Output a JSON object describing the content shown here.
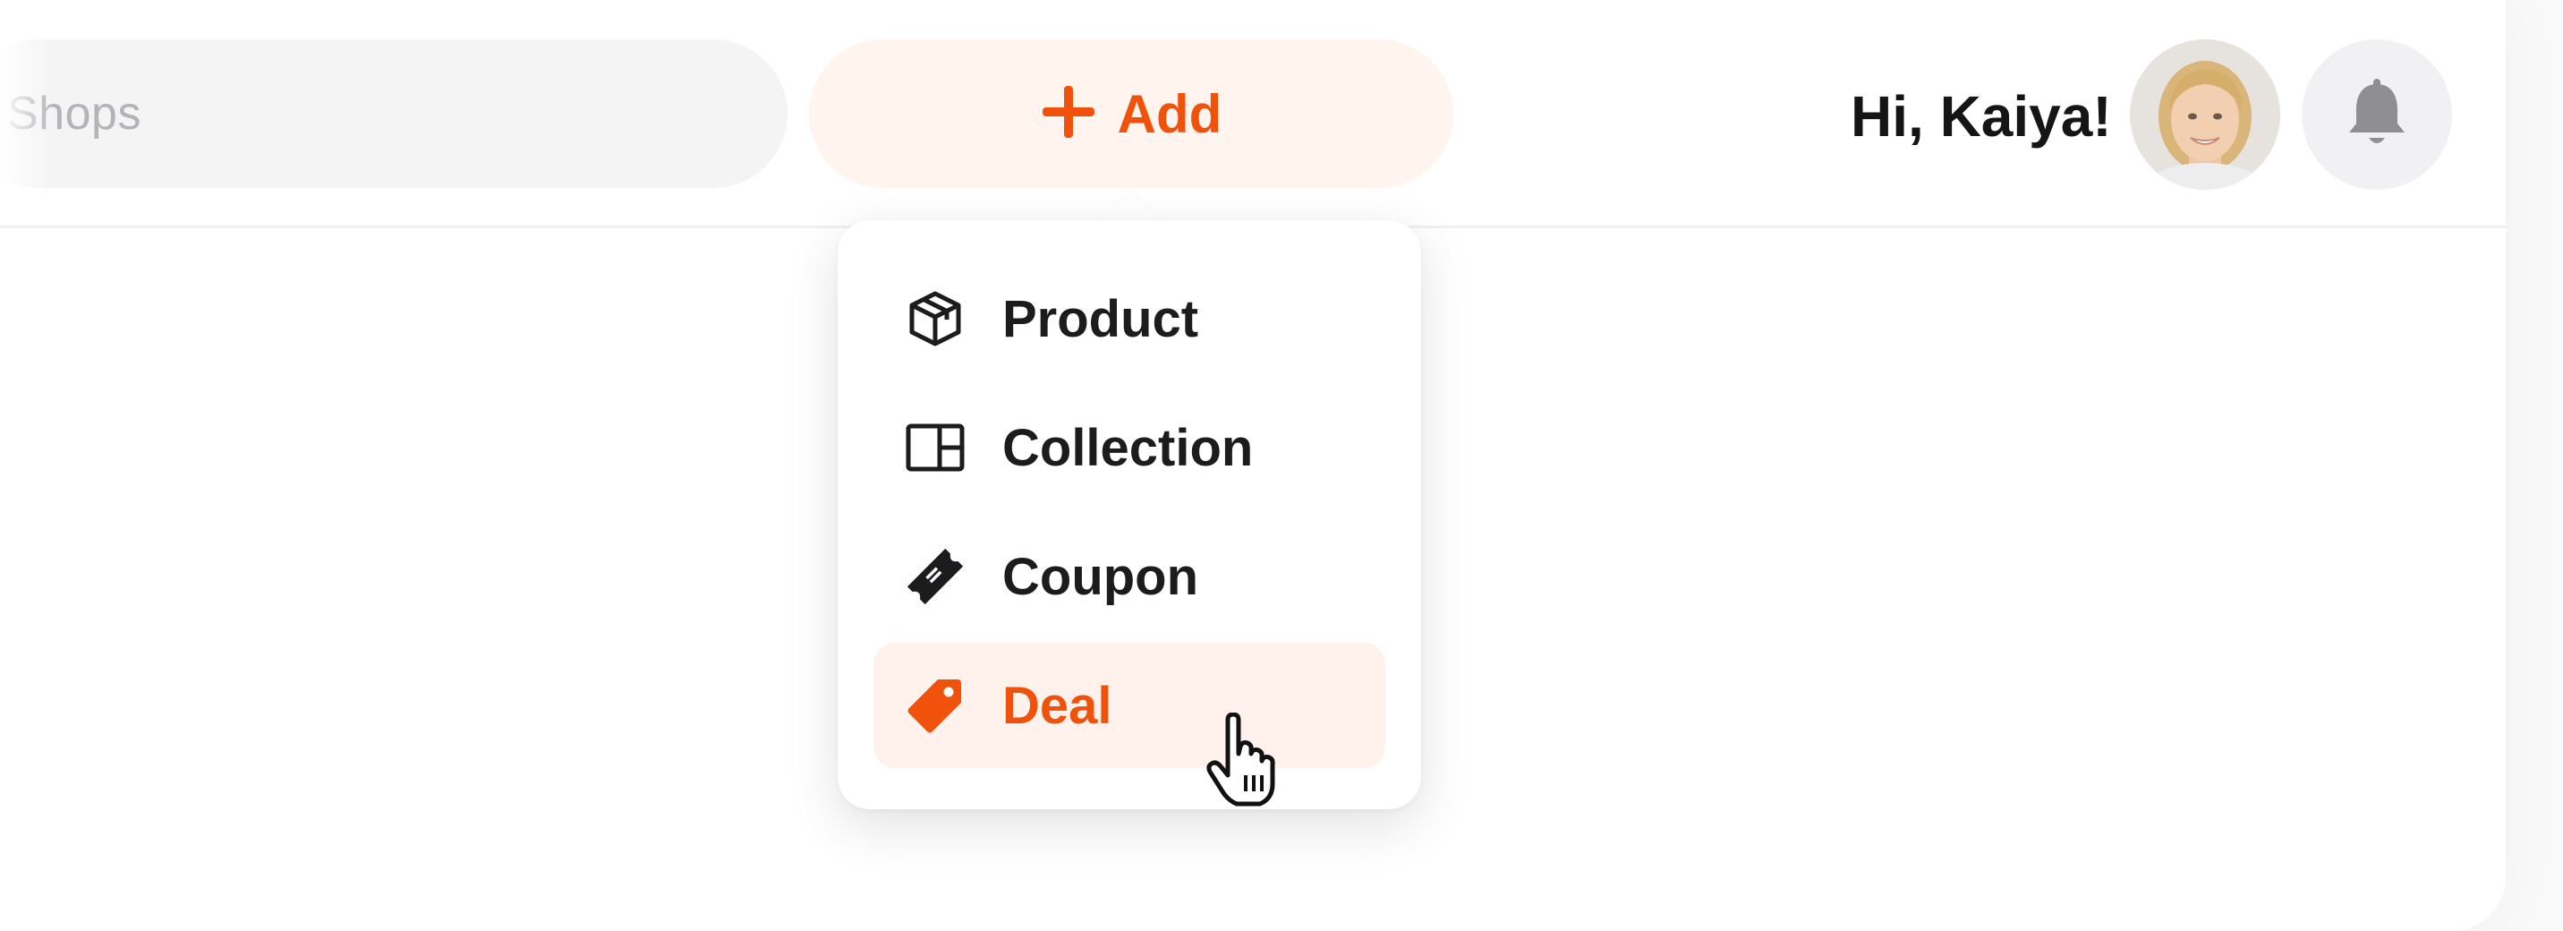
{
  "search": {
    "placeholder": "Shops"
  },
  "add_button": {
    "label": "Add",
    "icon": "plus-icon"
  },
  "header": {
    "greeting": "Hi, Kaiya!"
  },
  "avatar": {
    "description_icon": "user-avatar"
  },
  "notifications": {
    "icon": "bell-icon"
  },
  "add_menu": {
    "items": [
      {
        "label": "Product",
        "icon": "box-icon",
        "active": false
      },
      {
        "label": "Collection",
        "icon": "collection-icon",
        "active": false
      },
      {
        "label": "Coupon",
        "icon": "ticket-icon",
        "active": false
      },
      {
        "label": "Deal",
        "icon": "tag-icon",
        "active": true
      }
    ]
  },
  "colors": {
    "accent": "#f0520c",
    "accent_bg": "#fff4ee",
    "text": "#1c1c1e",
    "muted": "#b3b3b8"
  }
}
